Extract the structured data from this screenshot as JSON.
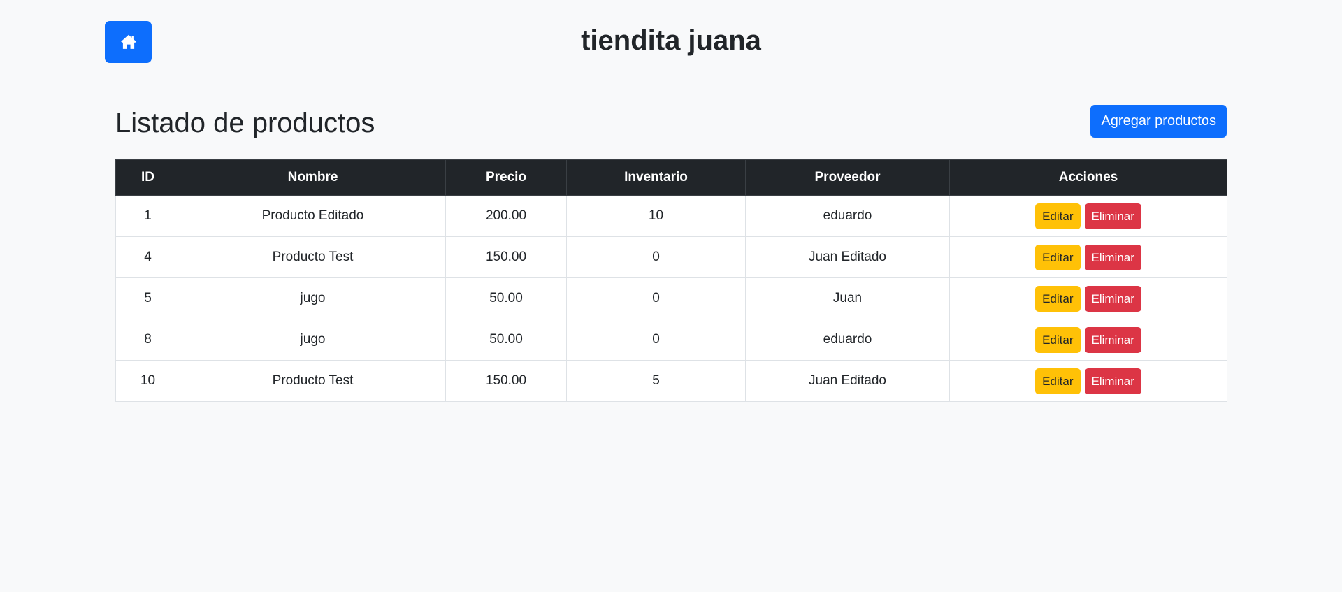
{
  "header": {
    "title": "tiendita juana",
    "home_icon": "home-icon",
    "accent_color": "#0d6efd"
  },
  "page": {
    "title": "Listado de productos",
    "add_button_label": "Agregar productos"
  },
  "table": {
    "columns": [
      "ID",
      "Nombre",
      "Precio",
      "Inventario",
      "Proveedor",
      "Acciones"
    ],
    "rows": [
      {
        "id": "1",
        "nombre": "Producto Editado",
        "precio": "200.00",
        "inventario": "10",
        "proveedor": "eduardo",
        "edit_label": "Editar",
        "delete_label": "Eliminar"
      },
      {
        "id": "4",
        "nombre": "Producto Test",
        "precio": "150.00",
        "inventario": "0",
        "proveedor": "Juan Editado",
        "edit_label": "Editar",
        "delete_label": "Eliminar"
      },
      {
        "id": "5",
        "nombre": "jugo",
        "precio": "50.00",
        "inventario": "0",
        "proveedor": "Juan",
        "edit_label": "Editar",
        "delete_label": "Eliminar"
      },
      {
        "id": "8",
        "nombre": "jugo",
        "precio": "50.00",
        "inventario": "0",
        "proveedor": "eduardo",
        "edit_label": "Editar",
        "delete_label": "Eliminar"
      },
      {
        "id": "10",
        "nombre": "Producto Test",
        "precio": "150.00",
        "inventario": "5",
        "proveedor": "Juan Editado",
        "edit_label": "Editar",
        "delete_label": "Eliminar"
      }
    ]
  },
  "colors": {
    "edit": "#ffc107",
    "delete": "#dc3545",
    "table_header": "#212529"
  }
}
